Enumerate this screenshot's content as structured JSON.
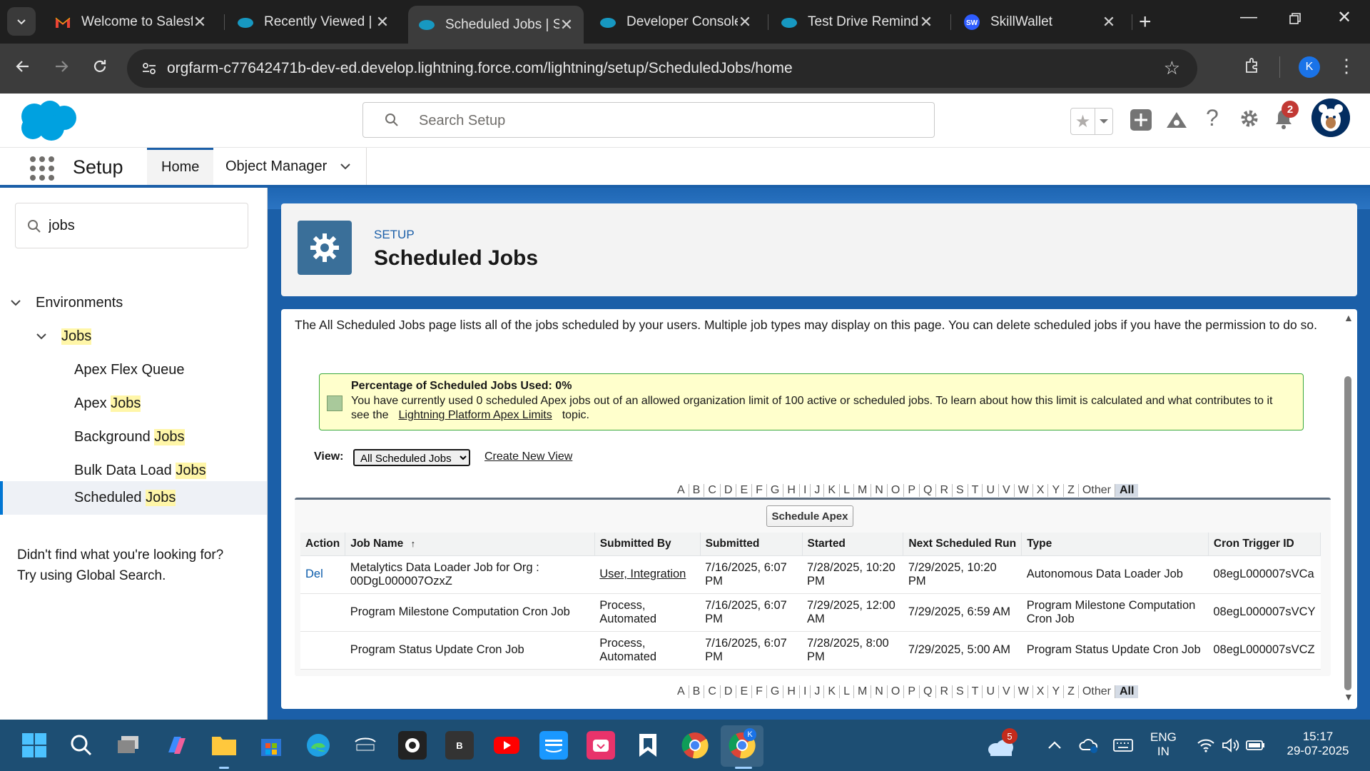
{
  "browser": {
    "tabs": [
      {
        "title": "Welcome to Salesf",
        "icon": "gmail-icon"
      },
      {
        "title": "Recently Viewed | ",
        "icon": "salesforce-icon"
      },
      {
        "title": "Scheduled Jobs | S",
        "icon": "salesforce-icon"
      },
      {
        "title": "Developer Console",
        "icon": "salesforce-icon"
      },
      {
        "title": "Test Drive Reminde",
        "icon": "salesforce-icon"
      },
      {
        "title": "SkillWallet",
        "icon": "skillwallet-icon"
      }
    ],
    "active_tab_index": 2,
    "skillwallet_favicon_text": "SW",
    "url": "orgfarm-c77642471b-dev-ed.develop.lightning.force.com/lightning/setup/ScheduledJobs/home",
    "profile_initial": "K"
  },
  "sf_header": {
    "search_placeholder": "Search Setup",
    "notification_count": "2"
  },
  "sf_nav": {
    "app_name": "Setup",
    "home_tab": "Home",
    "object_manager_tab": "Object Manager"
  },
  "sidebar": {
    "quick_find_value": "jobs",
    "env_label": "Environments",
    "jobs_label": "Jobs",
    "items": [
      {
        "pre": "Apex Flex Queue",
        "hl": ""
      },
      {
        "pre": "Apex ",
        "hl": "Jobs"
      },
      {
        "pre": "Background ",
        "hl": "Jobs"
      },
      {
        "pre": "Bulk Data Load ",
        "hl": "Jobs"
      },
      {
        "pre": "Scheduled ",
        "hl": "Jobs"
      }
    ],
    "help_line1": "Didn't find what you're looking for?",
    "help_line2": "Try using Global Search."
  },
  "page": {
    "eyebrow": "SETUP",
    "title": "Scheduled Jobs",
    "intro": "The All Scheduled Jobs page lists all of the jobs scheduled by your users. Multiple job types may display on this page. You can delete scheduled jobs if you have the permission to do so.",
    "msg_title": "Percentage of Scheduled Jobs Used: 0%",
    "msg_body_pre": "You have currently used 0 scheduled Apex jobs out of an allowed organization limit of 100 active or scheduled jobs. To learn about how this limit is calculated and what contributes to it see the",
    "msg_link": "Lightning Platform Apex Limits",
    "msg_body_post": "topic.",
    "view_label": "View:",
    "view_selected": "All Scheduled Jobs",
    "create_view": "Create New View",
    "alphabet": [
      "A",
      "B",
      "C",
      "D",
      "E",
      "F",
      "G",
      "H",
      "I",
      "J",
      "K",
      "L",
      "M",
      "N",
      "O",
      "P",
      "Q",
      "R",
      "S",
      "T",
      "U",
      "V",
      "W",
      "X",
      "Y",
      "Z",
      "Other",
      "All"
    ],
    "schedule_apex": "Schedule Apex",
    "columns": {
      "action": "Action",
      "job_name": "Job Name",
      "submitted_by": "Submitted By",
      "submitted": "Submitted",
      "started": "Started",
      "next_run": "Next Scheduled Run",
      "type": "Type",
      "cron_id": "Cron Trigger ID"
    },
    "sort_indicator": "↑",
    "rows": [
      {
        "action": "Del",
        "job_name": "Metalytics Data Loader Job for Org : 00DgL000007OzxZ",
        "submitted_by": "User, Integration",
        "submitted": "7/16/2025, 6:07 PM",
        "started": "7/28/2025, 10:20 PM",
        "next_run": "7/29/2025, 10:20 PM",
        "type": "Autonomous Data Loader Job",
        "cron_id": "08egL000007sVCa"
      },
      {
        "action": "",
        "job_name": "Program Milestone Computation Cron Job",
        "submitted_by": "Process, Automated",
        "submitted": "7/16/2025, 6:07 PM",
        "started": "7/29/2025, 12:00 AM",
        "next_run": "7/29/2025, 6:59 AM",
        "type": "Program Milestone Computation Cron Job",
        "cron_id": "08egL000007sVCY"
      },
      {
        "action": "",
        "job_name": "Program Status Update Cron Job",
        "submitted_by": "Process, Automated",
        "submitted": "7/16/2025, 6:07 PM",
        "started": "7/28/2025, 8:00 PM",
        "next_run": "7/29/2025, 5:00 AM",
        "type": "Program Status Update Cron Job",
        "cron_id": "08egL000007sVCZ"
      }
    ]
  },
  "taskbar": {
    "b_app_label": "B",
    "weather_badge": "5",
    "lang1": "ENG",
    "lang2": "IN",
    "time": "15:17",
    "date": "29-07-2025",
    "chrome_profile_badge": "K"
  }
}
